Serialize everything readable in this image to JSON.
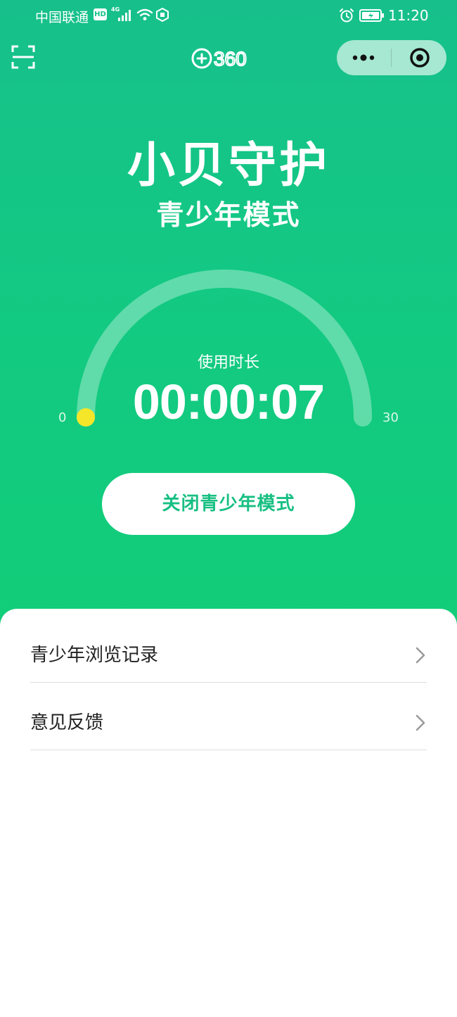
{
  "status_bar": {
    "carrier": "中国联通",
    "hd_badge": "HD",
    "network": "4G",
    "time": "11:20"
  },
  "nav": {
    "logo_text": "360"
  },
  "hero": {
    "title": "小贝守护",
    "subtitle": "青少年模式"
  },
  "gauge": {
    "label": "使用时长",
    "time": "00:00:07",
    "min_label": "0",
    "max_label": "30",
    "progress": 0
  },
  "actions": {
    "close_label": "关闭青少年模式"
  },
  "list": {
    "items": [
      {
        "label": "青少年浏览记录"
      },
      {
        "label": "意见反馈"
      }
    ]
  },
  "colors": {
    "brand_green": "#15c386",
    "button_text": "#17bf82",
    "indicator": "#f5e629"
  }
}
